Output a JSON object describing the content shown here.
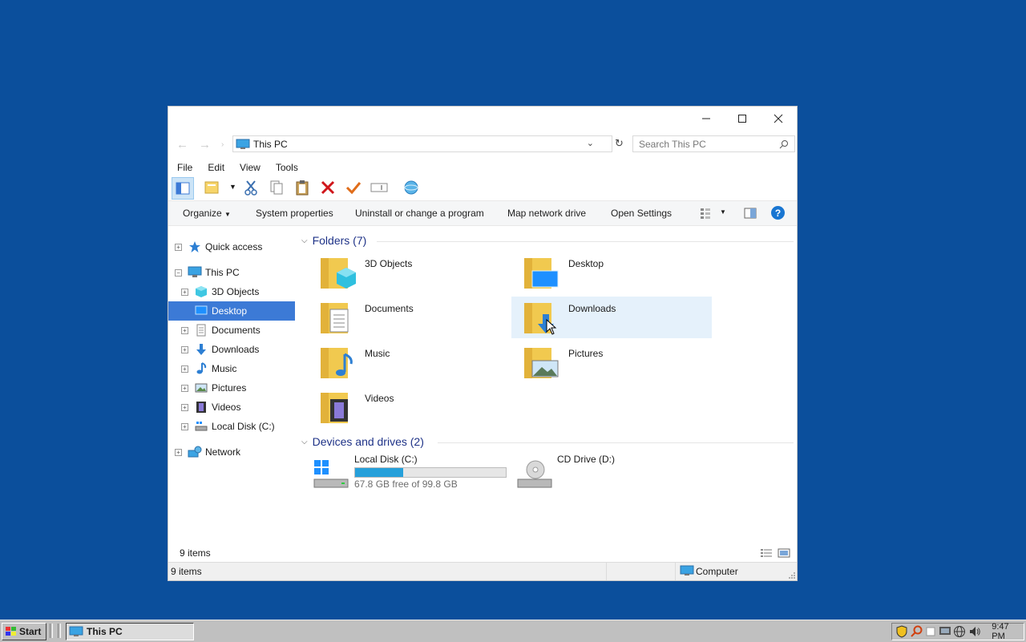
{
  "window": {
    "title": "This PC",
    "controls": {
      "minimize": "—",
      "maximize": "☐",
      "close": "✕"
    }
  },
  "address": {
    "path": "This PC",
    "search_placeholder": "Search This PC"
  },
  "menubar": [
    "File",
    "Edit",
    "View",
    "Tools"
  ],
  "commandbar": {
    "organize": "Organize",
    "system_properties": "System properties",
    "uninstall": "Uninstall or change a program",
    "map_network": "Map network drive",
    "open_settings": "Open Settings",
    "help": "?"
  },
  "nav": {
    "quick_access": "Quick access",
    "this_pc": "This PC",
    "children": [
      "3D Objects",
      "Desktop",
      "Documents",
      "Downloads",
      "Music",
      "Pictures",
      "Videos",
      "Local Disk (C:)"
    ],
    "network": "Network",
    "selected": "Desktop"
  },
  "content": {
    "folders_header": "Folders (7)",
    "folders": [
      "3D Objects",
      "Desktop",
      "Documents",
      "Downloads",
      "Music",
      "Pictures",
      "Videos"
    ],
    "hovered_folder": "Downloads",
    "devices_header": "Devices and drives (2)",
    "drives": [
      {
        "name": "Local Disk (C:)",
        "free": "67.8 GB free of 99.8 GB",
        "used_fraction": 0.32
      },
      {
        "name": "CD Drive (D:)"
      }
    ]
  },
  "details": {
    "item_count": "9 items"
  },
  "status": {
    "items": "9 items",
    "zone": "Computer"
  },
  "taskbar": {
    "start": "Start",
    "task": "This PC",
    "clock": "9:47 PM"
  },
  "colors": {
    "desktop": "#0b4f9c",
    "selection": "#3c7ad6",
    "hover": "#e5f1fb",
    "group_header": "#1e3287",
    "drive_fill": "#26a0da"
  }
}
